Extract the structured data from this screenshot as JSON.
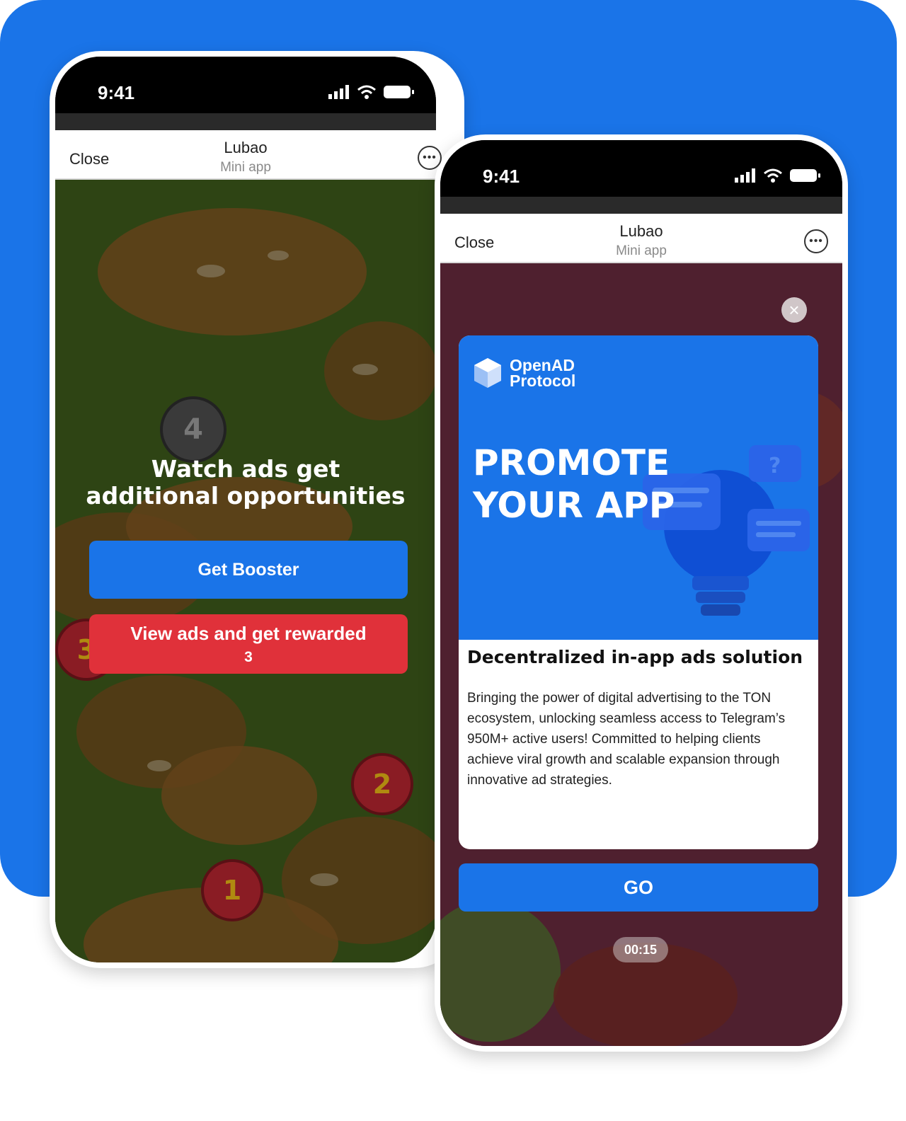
{
  "status_bar": {
    "time": "9:41"
  },
  "app": {
    "close_label": "Close",
    "title": "Lubao",
    "subtitle": "Mini app"
  },
  "left_screen": {
    "level_badges": [
      "4",
      "3",
      "2",
      "1"
    ],
    "headline": "Watch ads get additional opportunities",
    "booster_button": "Get Booster",
    "reward_button": {
      "label": "View ads and get rewarded",
      "count": "3"
    }
  },
  "right_screen": {
    "ad": {
      "brand_line1": "OpenAD",
      "brand_line2": "Protocol",
      "promo_line1": "PROMOTE",
      "promo_line2": "YOUR APP",
      "headline": "Decentralized in-app ads solution",
      "body": "Bringing the power of digital advertising to the TON ecosystem, unlocking seamless access to Telegram’s 950M+ active users! Committed to helping clients achieve viral growth and scalable expansion through innovative ad strategies."
    },
    "go_button": "GO",
    "timer": "00:15"
  },
  "colors": {
    "brand_blue": "#1a74e8",
    "reward_red": "#e0313a"
  }
}
